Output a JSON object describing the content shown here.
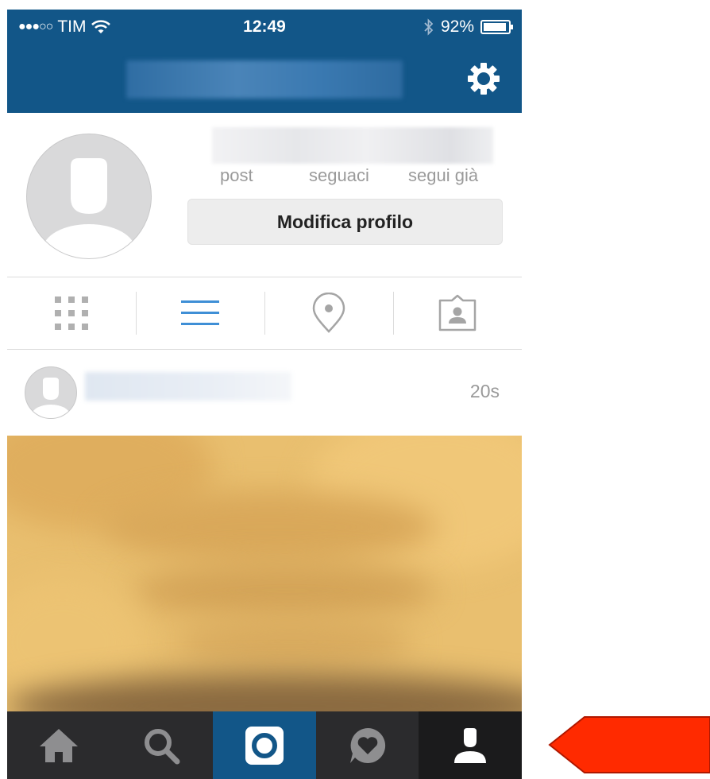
{
  "status_bar": {
    "signal_dots": "●●●○○",
    "carrier": "TIM",
    "time": "12:49",
    "battery_percent": "92%",
    "battery_level": 0.92
  },
  "profile": {
    "stats": [
      {
        "label": "post"
      },
      {
        "label": "seguaci"
      },
      {
        "label": "segui già"
      }
    ],
    "edit_button": "Modifica profilo"
  },
  "view_tabs": [
    {
      "icon": "grid-icon",
      "active": false
    },
    {
      "icon": "list-icon",
      "active": true
    },
    {
      "icon": "location-pin-icon",
      "active": false
    },
    {
      "icon": "tagged-photos-icon",
      "active": false
    }
  ],
  "post": {
    "time_ago": "20s"
  },
  "tab_bar": [
    {
      "icon": "home-icon"
    },
    {
      "icon": "search-icon"
    },
    {
      "icon": "camera-icon",
      "selected": true
    },
    {
      "icon": "activity-icon"
    },
    {
      "icon": "profile-icon",
      "active": true
    }
  ],
  "colors": {
    "header": "#125688",
    "active_tab": "#3f8fd6",
    "tabbar": "#2b2b2d",
    "annotation_arrow": "#ff2a00"
  }
}
